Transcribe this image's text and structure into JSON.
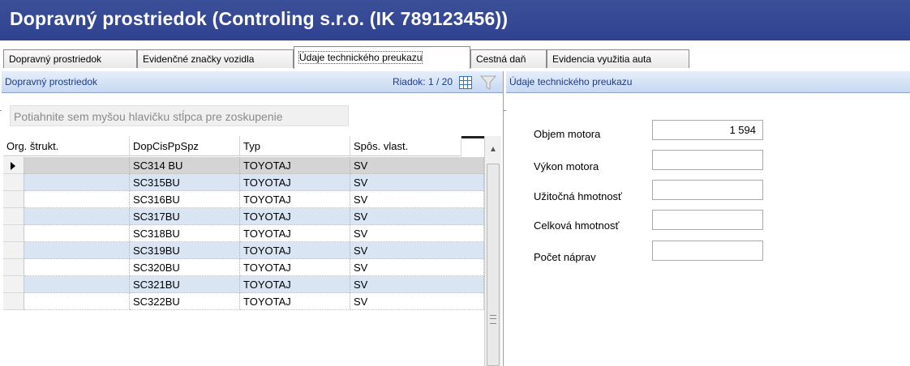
{
  "window": {
    "title": "Dopravný prostriedok (Controling s.r.o. (IK 789123456))"
  },
  "tabs": [
    {
      "label": "Dopravný prostriedok",
      "active": false
    },
    {
      "label": "Evidenčné značky vozidla",
      "active": false
    },
    {
      "label": "Údaje technického preukazu",
      "active": true
    },
    {
      "label": "Cestná daň",
      "active": false
    },
    {
      "label": "Evidencia využitia auta",
      "active": false
    }
  ],
  "left_panel": {
    "title": "Dopravný prostriedok",
    "row_info": "Riadok: 1 / 20",
    "group_placeholder": "Potiahnite sem myšou hlavičku stĺpca pre zoskupenie",
    "columns": [
      "Org. štrukt.",
      "DopCisPpSpz",
      "Typ",
      "Spôs. vlast."
    ],
    "rows": [
      {
        "org": "",
        "spz": "SC314 BU",
        "typ": "TOYOTAJ",
        "vlast": "SV"
      },
      {
        "org": "",
        "spz": "SC315BU",
        "typ": "TOYOTAJ",
        "vlast": "SV"
      },
      {
        "org": "",
        "spz": "SC316BU",
        "typ": "TOYOTAJ",
        "vlast": "SV"
      },
      {
        "org": "",
        "spz": "SC317BU",
        "typ": "TOYOTAJ",
        "vlast": "SV"
      },
      {
        "org": "",
        "spz": "SC318BU",
        "typ": "TOYOTAJ",
        "vlast": "SV"
      },
      {
        "org": "",
        "spz": "SC319BU",
        "typ": "TOYOTAJ",
        "vlast": "SV"
      },
      {
        "org": "",
        "spz": "SC320BU",
        "typ": "TOYOTAJ",
        "vlast": "SV"
      },
      {
        "org": "",
        "spz": "SC321BU",
        "typ": "TOYOTAJ",
        "vlast": "SV"
      },
      {
        "org": "",
        "spz": "SC322BU",
        "typ": "TOYOTAJ",
        "vlast": "SV"
      }
    ],
    "selected_row": 0
  },
  "right_panel": {
    "title": "Údaje technického preukazu",
    "fields": [
      {
        "label": "Objem motora",
        "value": "1 594"
      },
      {
        "label": "Výkon motora",
        "value": ""
      },
      {
        "label": "Užitočná hmotnosť",
        "value": ""
      },
      {
        "label": "Celková hmotnosť",
        "value": ""
      },
      {
        "label": "Počet náprav",
        "value": ""
      }
    ]
  },
  "colors": {
    "title_bar": "#3b4f99",
    "panel_header": "#c7d8f2",
    "alt_row": "#d9e5f3",
    "selected_row": "#d4d4d4"
  }
}
